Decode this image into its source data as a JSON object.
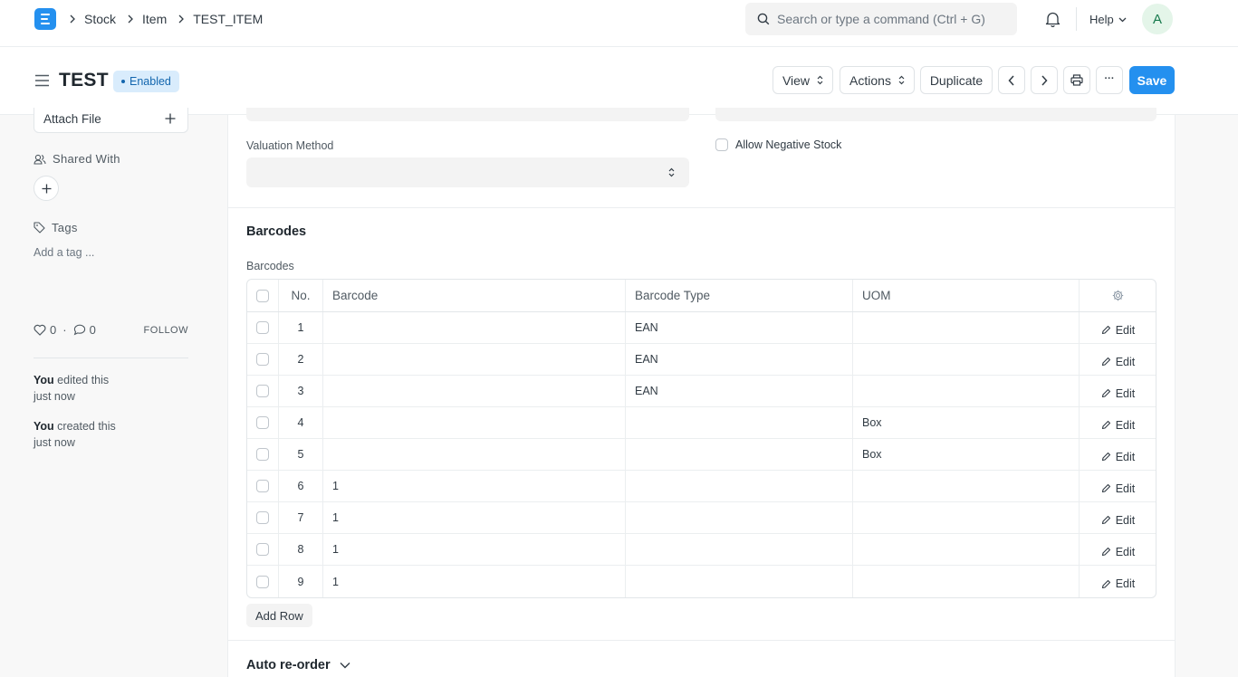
{
  "navbar": {
    "logo_letter": "E",
    "breadcrumbs": [
      "Stock",
      "Item",
      "TEST_ITEM"
    ],
    "search": {
      "placeholder": "Search or type a command (Ctrl + G)"
    },
    "help_label": "Help",
    "avatar_initial": "A"
  },
  "page": {
    "title": "TEST",
    "status": "Enabled",
    "buttons": {
      "view": "View",
      "actions": "Actions",
      "duplicate": "Duplicate",
      "more": "···",
      "save": "Save"
    }
  },
  "sidebar": {
    "attach_label": "Attach File",
    "shared_with_label": "Shared With",
    "tags_label": "Tags",
    "add_tag_label": "Add a tag ...",
    "likes": "0",
    "comments": "0",
    "follow_label": "FOLLOW",
    "activity": [
      {
        "user": "You",
        "action": " edited this",
        "time": "just now"
      },
      {
        "user": "You",
        "action": " created this",
        "time": "just now"
      }
    ]
  },
  "form": {
    "valuation_method_label": "Valuation Method",
    "valuation_method_value": "",
    "allow_negative_stock_label": "Allow Negative Stock",
    "barcodes_section_title": "Barcodes",
    "barcodes_table_label": "Barcodes",
    "columns": {
      "no": "No.",
      "barcode": "Barcode",
      "barcode_type": "Barcode Type",
      "uom": "UOM"
    },
    "edit_label": "Edit",
    "rows": [
      {
        "no": "1",
        "barcode": "",
        "barcode_type": "EAN",
        "uom": ""
      },
      {
        "no": "2",
        "barcode": "",
        "barcode_type": "EAN",
        "uom": ""
      },
      {
        "no": "3",
        "barcode": "",
        "barcode_type": "EAN",
        "uom": ""
      },
      {
        "no": "4",
        "barcode": "",
        "barcode_type": "",
        "uom": "Box"
      },
      {
        "no": "5",
        "barcode": "",
        "barcode_type": "",
        "uom": "Box"
      },
      {
        "no": "6",
        "barcode": "1",
        "barcode_type": "",
        "uom": ""
      },
      {
        "no": "7",
        "barcode": "1",
        "barcode_type": "",
        "uom": ""
      },
      {
        "no": "8",
        "barcode": "1",
        "barcode_type": "",
        "uom": ""
      },
      {
        "no": "9",
        "barcode": "1",
        "barcode_type": "",
        "uom": ""
      }
    ],
    "add_row_label": "Add Row",
    "auto_reorder_title": "Auto re-order"
  }
}
